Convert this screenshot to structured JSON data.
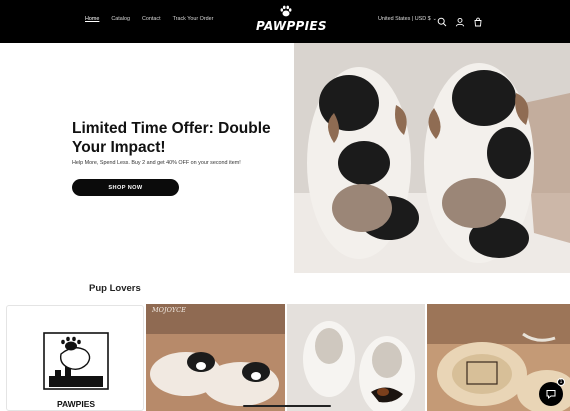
{
  "header": {
    "nav": [
      {
        "label": "Home",
        "active": true
      },
      {
        "label": "Catalog",
        "active": false
      },
      {
        "label": "Contact",
        "active": false
      },
      {
        "label": "Track Your Order",
        "active": false
      }
    ],
    "brand": "PAWPPIES",
    "country": "United States | USD $",
    "icons": [
      "search-icon",
      "account-icon",
      "cart-icon"
    ]
  },
  "hero": {
    "title": "Limited Time Offer: Double Your Impact!",
    "subtitle": "Help More, Spend Less. Buy 2 and get 40% OFF on your second item!",
    "button": "SHOP NOW",
    "image": "cow-slippers-photo"
  },
  "collection": {
    "title": "Pup Lovers",
    "logo_label": "PAWPIES",
    "tiles": [
      {
        "image": "boston-terrier-slippers-photo",
        "watermark": "MOJOYCE"
      },
      {
        "image": "dachshund-slippers-photo"
      },
      {
        "image": "pug-slippers-photo"
      }
    ]
  },
  "chat": {
    "badge": "1"
  },
  "colors": {
    "header_bg": "#000000",
    "button_bg": "#0b0b0b",
    "text": "#111111"
  }
}
